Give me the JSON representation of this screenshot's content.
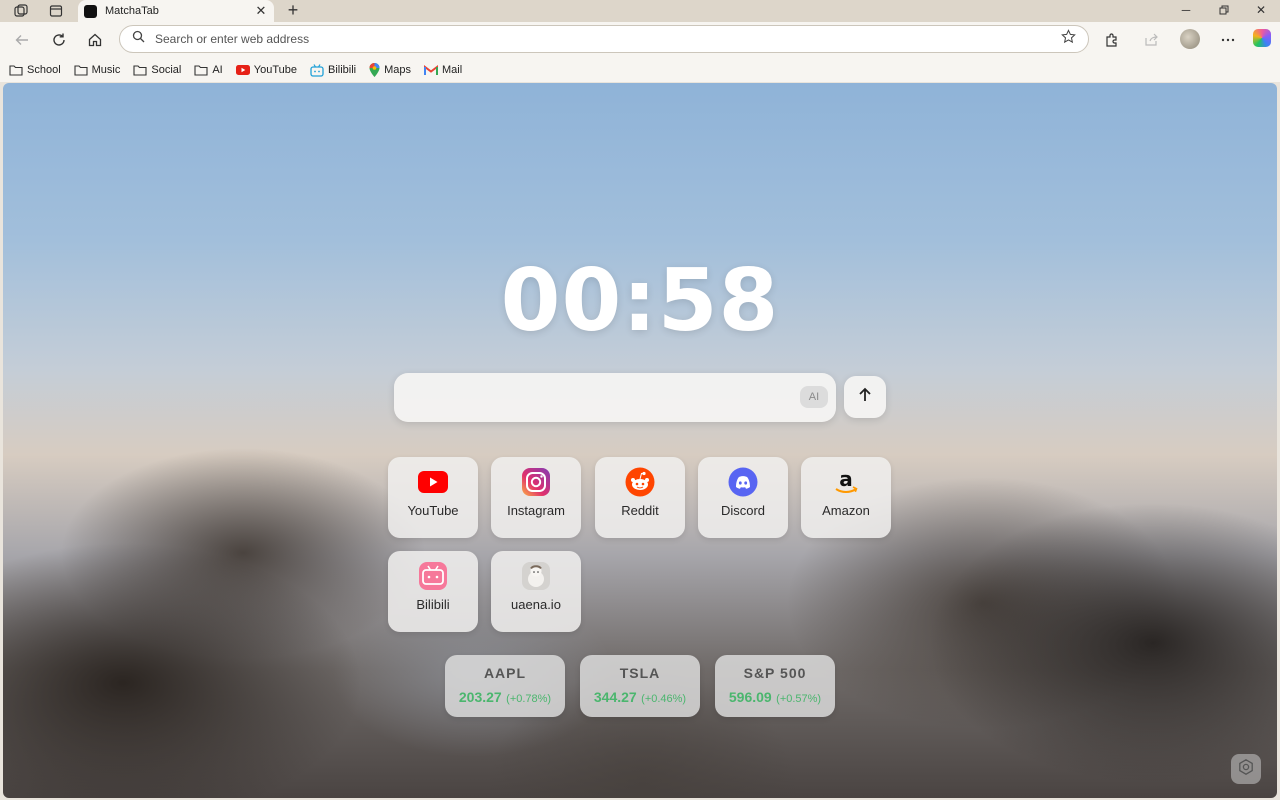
{
  "browser": {
    "tab_title": "MatchaTab",
    "address_placeholder": "Search or enter web address"
  },
  "bookmarks": [
    {
      "label": "School",
      "icon": "folder-icon"
    },
    {
      "label": "Music",
      "icon": "folder-icon"
    },
    {
      "label": "Social",
      "icon": "folder-icon"
    },
    {
      "label": "AI",
      "icon": "folder-icon"
    },
    {
      "label": "YouTube",
      "icon": "youtube-icon"
    },
    {
      "label": "Bilibili",
      "icon": "bilibili-icon"
    },
    {
      "label": "Maps",
      "icon": "maps-pin-icon"
    },
    {
      "label": "Mail",
      "icon": "gmail-icon"
    }
  ],
  "newtab": {
    "clock": "00:58",
    "search_placeholder": "",
    "ai_label": "AI",
    "shortcuts": [
      {
        "label": "YouTube",
        "icon": "youtube-icon"
      },
      {
        "label": "Instagram",
        "icon": "instagram-icon"
      },
      {
        "label": "Reddit",
        "icon": "reddit-icon"
      },
      {
        "label": "Discord",
        "icon": "discord-icon"
      },
      {
        "label": "Amazon",
        "icon": "amazon-icon"
      },
      {
        "label": "Bilibili",
        "icon": "bilibili-icon"
      },
      {
        "label": "uaena.io",
        "icon": "uaena-icon"
      }
    ],
    "stocks": [
      {
        "symbol": "AAPL",
        "price": "203.27",
        "change": "(+0.78%)"
      },
      {
        "symbol": "TSLA",
        "price": "344.27",
        "change": "(+0.46%)"
      },
      {
        "symbol": "S&P 500",
        "price": "596.09",
        "change": "(+0.57%)"
      }
    ]
  },
  "colors": {
    "stock_up": "#4bb66e",
    "clock": "#ffffff"
  }
}
